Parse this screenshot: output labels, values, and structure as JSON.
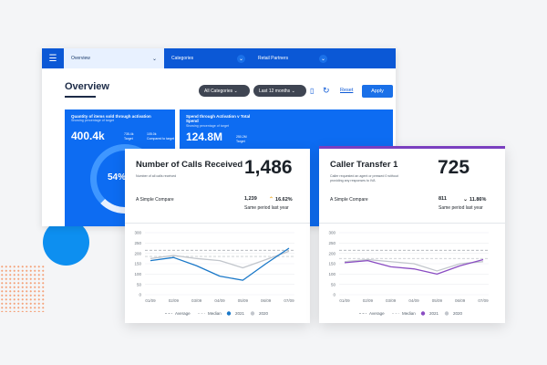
{
  "header": {
    "tabs": [
      {
        "label": "Overview"
      },
      {
        "label": "Categories"
      },
      {
        "label": "Retail Partners"
      }
    ]
  },
  "overview": {
    "title": "Overview",
    "filters": {
      "category": "All Categories",
      "period": "Last 12 months"
    },
    "reset_label": "Reset",
    "apply_label": "Apply",
    "card1": {
      "title": "Quantity of items sold through activation",
      "subtitle": "Showing percentage of target",
      "value": "400.4k",
      "mini_value": "735.4k",
      "mini_caption": "Target",
      "mini_value2": "105.0k",
      "mini_caption2": "Compared to target",
      "percent": "54%"
    },
    "card2": {
      "title": "Spend through Activation v Total Spend",
      "subtitle": "Showing percentage of target",
      "value": "124.8M",
      "mini_value": "250.2M",
      "mini_caption": "Target"
    }
  },
  "calls_card": {
    "title": "Number of Calls Received",
    "subtitle": "Number of all calls received",
    "value": "1,486",
    "compare_label": "A Simple Compare",
    "compare_value": "1,239",
    "compare_pct": "16.62%",
    "compare_caption": "Same period last year"
  },
  "transfer_card": {
    "title": "Caller Transfer 1",
    "subtitle": "Caller requested an agent or pressed 0 without providing any responses to IVA",
    "value": "725",
    "compare_label": "A Simple Compare",
    "compare_value": "811",
    "compare_pct": "11.86%",
    "compare_caption": "Same period last year"
  },
  "colors": {
    "brand_blue": "#0b58d6",
    "series_2021_calls": "#1a78c8",
    "series_2021_transfer": "#8a4cc2",
    "series_2020": "#c2c6cc",
    "average": "#9aa0a6",
    "median": "#c9ccd0"
  },
  "chart_data": [
    {
      "type": "line",
      "categories": [
        "01/09",
        "02/09",
        "03/09",
        "04/09",
        "05/09",
        "06/09",
        "07/09"
      ],
      "ylim": [
        0,
        300
      ],
      "yticks": [
        "0",
        "50",
        "100",
        "150",
        "200",
        "250",
        "300"
      ],
      "series": [
        {
          "name": "2021",
          "values": [
            165,
            180,
            140,
            90,
            70,
            150,
            225
          ],
          "color": "#1a78c8"
        },
        {
          "name": "2020",
          "values": [
            175,
            190,
            175,
            165,
            130,
            170,
            210
          ],
          "color": "#c2c6cc"
        }
      ],
      "reference_lines": [
        {
          "name": "Average",
          "value": 215,
          "color": "#9aa0a6",
          "style": "dashed"
        },
        {
          "name": "Median",
          "value": 185,
          "color": "#c9ccd0",
          "style": "dashed"
        }
      ],
      "legend": [
        "Average",
        "Median",
        "2021",
        "2020"
      ],
      "legend_position": "bottom"
    },
    {
      "type": "line",
      "categories": [
        "01/09",
        "02/09",
        "03/09",
        "04/09",
        "05/09",
        "06/09",
        "07/09"
      ],
      "ylim": [
        0,
        300
      ],
      "yticks": [
        "0",
        "50",
        "100",
        "150",
        "200",
        "250",
        "300"
      ],
      "series": [
        {
          "name": "2021",
          "values": [
            155,
            165,
            135,
            125,
            100,
            140,
            170
          ],
          "color": "#8a4cc2"
        },
        {
          "name": "2020",
          "values": [
            160,
            170,
            160,
            150,
            115,
            150,
            160
          ],
          "color": "#c2c6cc"
        }
      ],
      "reference_lines": [
        {
          "name": "Average",
          "value": 215,
          "color": "#9aa0a6",
          "style": "dashed"
        },
        {
          "name": "Median",
          "value": 175,
          "color": "#c9ccd0",
          "style": "dashed"
        }
      ],
      "legend": [
        "Average",
        "Median",
        "2021",
        "2020"
      ],
      "legend_position": "bottom"
    }
  ]
}
